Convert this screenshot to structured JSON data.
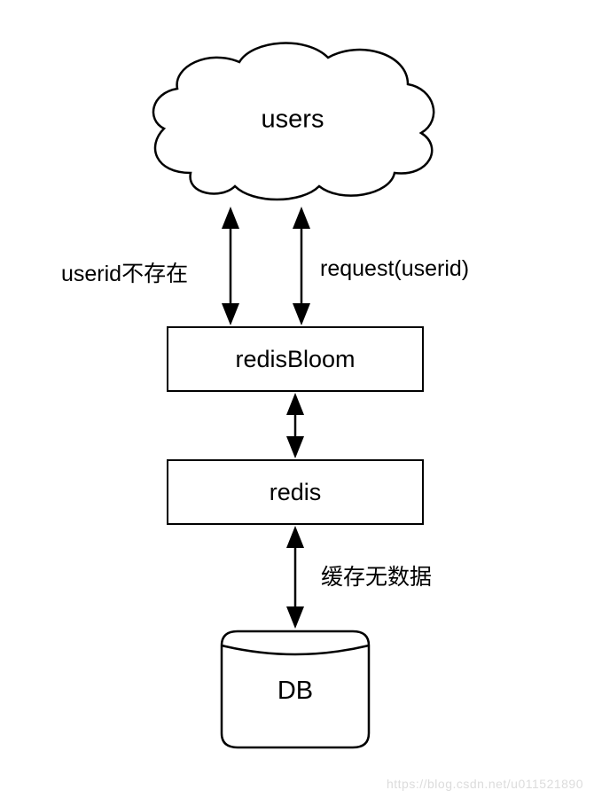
{
  "nodes": {
    "users": {
      "label": "users"
    },
    "redisBloom": {
      "label": "redisBloom"
    },
    "redis": {
      "label": "redis"
    },
    "db": {
      "label": "DB"
    }
  },
  "edges": {
    "left_users_bloom": {
      "label": "userid不存在"
    },
    "right_users_bloom": {
      "label": "request(userid)"
    },
    "bloom_redis": {
      "label": ""
    },
    "redis_db": {
      "label": "缓存无数据"
    }
  },
  "watermark": "https://blog.csdn.net/u011521890"
}
